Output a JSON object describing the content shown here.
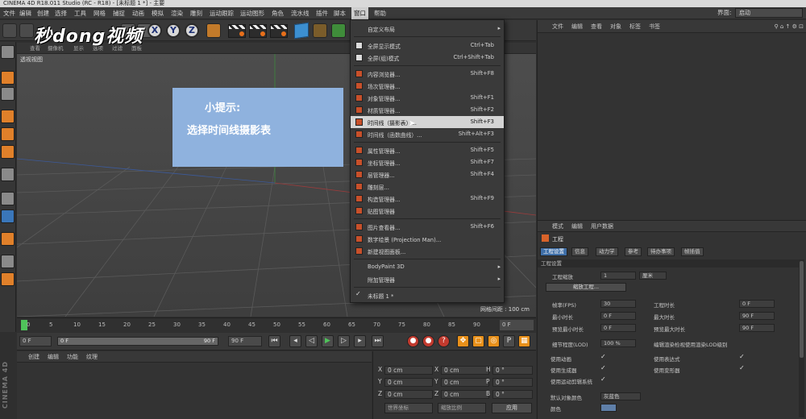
{
  "window": {
    "title": "CINEMA 4D R18.011 Studio (RC - R18) - [未标题 1 *] - 主要"
  },
  "menubar": {
    "items": [
      "文件",
      "编辑",
      "创建",
      "选择",
      "工具",
      "网格",
      "捕捉",
      "动画",
      "模拟",
      "渲染",
      "雕刻",
      "运动跟踪",
      "运动图形",
      "角色",
      "流水线",
      "插件",
      "脚本",
      "窗口",
      "帮助"
    ],
    "active": "窗口",
    "layout_label": "界面:",
    "layout_value": "启动"
  },
  "watermark": {
    "text": "秒dong视频"
  },
  "toolbar": {
    "axis_x": "X",
    "axis_y": "Y",
    "axis_z": "Z"
  },
  "viewport": {
    "menu": [
      "查看",
      "摄像机",
      "显示",
      "选项",
      "过滤",
      "面板"
    ],
    "label": "透视视图",
    "scale_info": "网格间距 : 100 cm"
  },
  "hint": {
    "title": "小提示:",
    "subtitle": "选择时间线摄影表"
  },
  "window_menu": {
    "items": [
      {
        "label": "自定义布局",
        "arrow": "▸"
      },
      {
        "label": "全屏显示模式",
        "shortcut": "Ctrl+Tab"
      },
      {
        "label": "全屏(组)模式",
        "shortcut": "Ctrl+Shift+Tab"
      },
      {
        "label": "内容浏览器...",
        "shortcut": "Shift+F8"
      },
      {
        "label": "场次管理器..."
      },
      {
        "label": "对象管理器...",
        "shortcut": "Shift+F1"
      },
      {
        "label": "材质管理器...",
        "shortcut": "Shift+F2"
      },
      {
        "label": "时间线（摄影表）...",
        "shortcut": "Shift+F3"
      },
      {
        "label": "时间线（函数曲线）...",
        "shortcut": "Shift+Alt+F3"
      },
      {
        "label": "属性管理器...",
        "shortcut": "Shift+F5"
      },
      {
        "label": "坐标管理器...",
        "shortcut": "Shift+F7"
      },
      {
        "label": "层管理器...",
        "shortcut": "Shift+F4"
      },
      {
        "label": "雕刻层..."
      },
      {
        "label": "构造管理器...",
        "shortcut": "Shift+F9"
      },
      {
        "label": "贴图管理器"
      },
      {
        "label": "图片查看器...",
        "shortcut": "Shift+F6"
      },
      {
        "label": "数字绘景 (Projection Man)..."
      },
      {
        "label": "新建视图面板..."
      },
      {
        "label": "BodyPaint 3D",
        "arrow": "▸"
      },
      {
        "label": "附加管理器",
        "arrow": "▸"
      },
      {
        "label": "未标题 1 *",
        "check": "✓"
      }
    ]
  },
  "timeline": {
    "ticks": [
      "0",
      "5",
      "10",
      "15",
      "20",
      "25",
      "30",
      "35",
      "40",
      "45",
      "50",
      "55",
      "60",
      "65",
      "70",
      "75",
      "80",
      "85",
      "90"
    ],
    "current_frame": "0 F"
  },
  "controls": {
    "start_frame": "0 F",
    "slider_start": "0 F",
    "slider_end": "90 F",
    "end_frame": "90 F"
  },
  "material_panel": {
    "menu": [
      "创建",
      "编辑",
      "功能",
      "纹理"
    ]
  },
  "coords": {
    "rows": [
      {
        "a": "X",
        "av": "0 cm",
        "b": "X",
        "bv": "0 cm",
        "c": "H",
        "cv": "0 °"
      },
      {
        "a": "Y",
        "av": "0 cm",
        "b": "Y",
        "bv": "0 cm",
        "c": "P",
        "cv": "0 °"
      },
      {
        "a": "Z",
        "av": "0 cm",
        "b": "Z",
        "bv": "0 cm",
        "c": "B",
        "cv": "0 °"
      }
    ],
    "mode_a": "世界坐标",
    "mode_b": "缩放比例",
    "apply": "应用"
  },
  "app_side_label": "CINEMA 4D",
  "object_manager": {
    "menu": [
      "文件",
      "编辑",
      "查看",
      "对象",
      "标签",
      "书签"
    ]
  },
  "attribute_manager": {
    "menu": [
      "模式",
      "编辑",
      "用户数据"
    ],
    "title": "工程",
    "tabs": [
      "工程设置",
      "信息",
      "动力学",
      "参考",
      "待办事项",
      "帧插值"
    ],
    "section": "工程设置",
    "scale_label": "工程缩放",
    "scale_value": "1",
    "scale_unit": "厘米",
    "scale_btn": "缩放工程...",
    "fps_label": "帧率(FPS)",
    "fps_value": "30",
    "min_time_label": "最小时长",
    "min_time_value": "0 F",
    "preview_min_label": "预览最小时长",
    "preview_min_value": "0 F",
    "lod_label": "细节程度(LOD)",
    "lod_value": "100 %",
    "duration_label": "工程时长",
    "duration_value": "0 F",
    "max_time_label": "最大时长",
    "max_time_value": "90 F",
    "preview_max_label": "预览最大时长",
    "preview_max_value": "90 F",
    "lod_render_label": "编辑渲染检视使用渲染LOD级别",
    "use_anim_label": "使用动画",
    "use_expr_label": "使用表达式",
    "use_gen_label": "使用生成器",
    "use_deform_label": "使用变形器",
    "use_mograph_label": "使用运动剪辑系统",
    "check": "✓",
    "default_color_label": "默认对象颜色",
    "default_color_value": "灰蓝色",
    "color_label": "颜色"
  }
}
